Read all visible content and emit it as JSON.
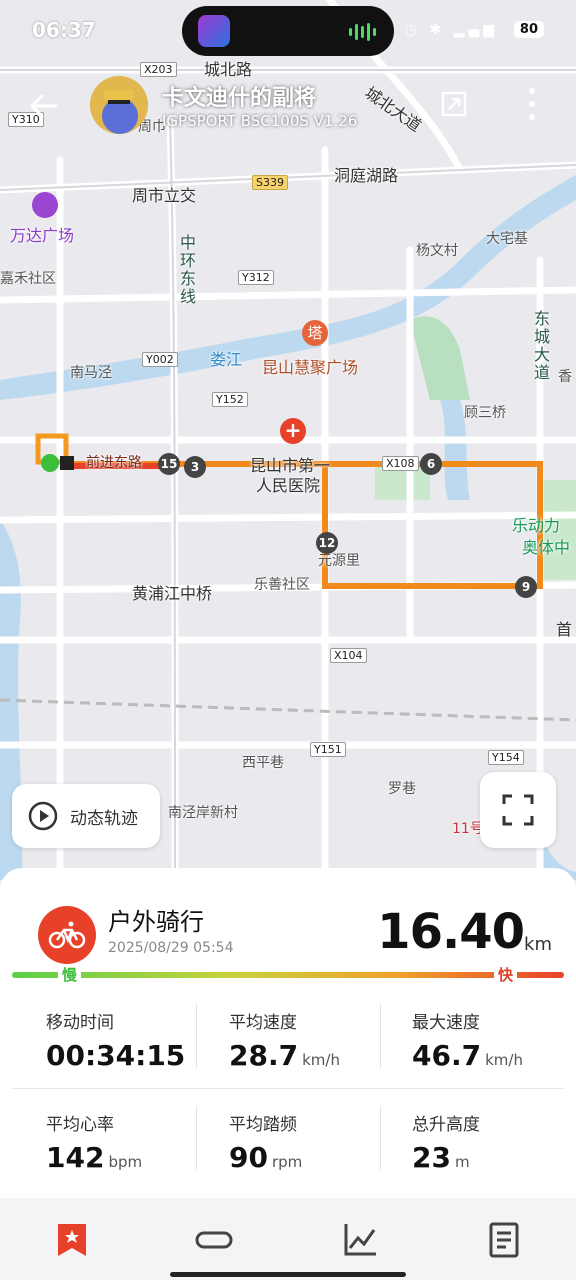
{
  "status_bar": {
    "time": "06:37",
    "battery": "80"
  },
  "header": {
    "title": "卡文迪什的副将",
    "subtitle": "IGPSPORT BSC100S  V1.26"
  },
  "map": {
    "labels": {
      "chengbei_rd": "城北路",
      "dongting_rd": "洞庭湖路",
      "chengbei_ave": "城北大道",
      "zhoushi_overpass": "周市立交",
      "wanda": "万达广场",
      "yangwencun": "杨文村",
      "dazhaiji": "大宅基",
      "zhonghuan_east": "中环东线",
      "lou_river": "娄江",
      "huiju": "昆山慧聚广场",
      "nanmajing": "南马泾",
      "gusanqiao": "顾三桥",
      "dongcheng_ave": "东城大道",
      "renmin_hospital": "人民医院",
      "kunshan_first": "昆山市第一",
      "yuanli": "元源里",
      "lotte": "乐动力",
      "sports": "奥体中",
      "huangpujiang_bridge": "黄浦江中桥",
      "leshan_community": "乐善社区",
      "xiping_lane": "西平巷",
      "luo_lane": "罗巷",
      "nanjingan": "南泾岸新村",
      "zhouji": "周巾",
      "qiandeng": "前进东路",
      "heshe": "嘉禾社区",
      "shou": "首",
      "xiang": "香"
    },
    "road_codes": {
      "x203": "X203",
      "y310": "Y310",
      "s339": "S339",
      "y312": "Y312",
      "y002": "Y002",
      "y152": "Y152",
      "x104": "X104",
      "y151": "Y151",
      "y154": "Y154",
      "x108": "X108"
    },
    "km_markers": [
      "15",
      "3",
      "6",
      "12",
      "9"
    ],
    "metro_line": "11号"
  },
  "replay_button": {
    "label": "动态轨迹"
  },
  "activity": {
    "sport": "户外骑行",
    "date": "2025/08/29 05:54",
    "distance": "16.40",
    "distance_unit": "km",
    "slow_label": "慢",
    "fast_label": "快"
  },
  "stats": [
    {
      "label": "移动时间",
      "value": "00:34:15",
      "unit": ""
    },
    {
      "label": "平均速度",
      "value": "28.7",
      "unit": "km/h"
    },
    {
      "label": "最大速度",
      "value": "46.7",
      "unit": "km/h"
    },
    {
      "label": "平均心率",
      "value": "142",
      "unit": "bpm"
    },
    {
      "label": "平均踏频",
      "value": "90",
      "unit": "rpm"
    },
    {
      "label": "总升高度",
      "value": "23",
      "unit": "m"
    }
  ],
  "colors": {
    "accent_red": "#e8412a",
    "slow_green": "#3bbf3b",
    "track_orange": "#f08a1c"
  },
  "tabs": [
    "bookmark-icon",
    "route-icon",
    "chart-icon",
    "list-icon"
  ]
}
